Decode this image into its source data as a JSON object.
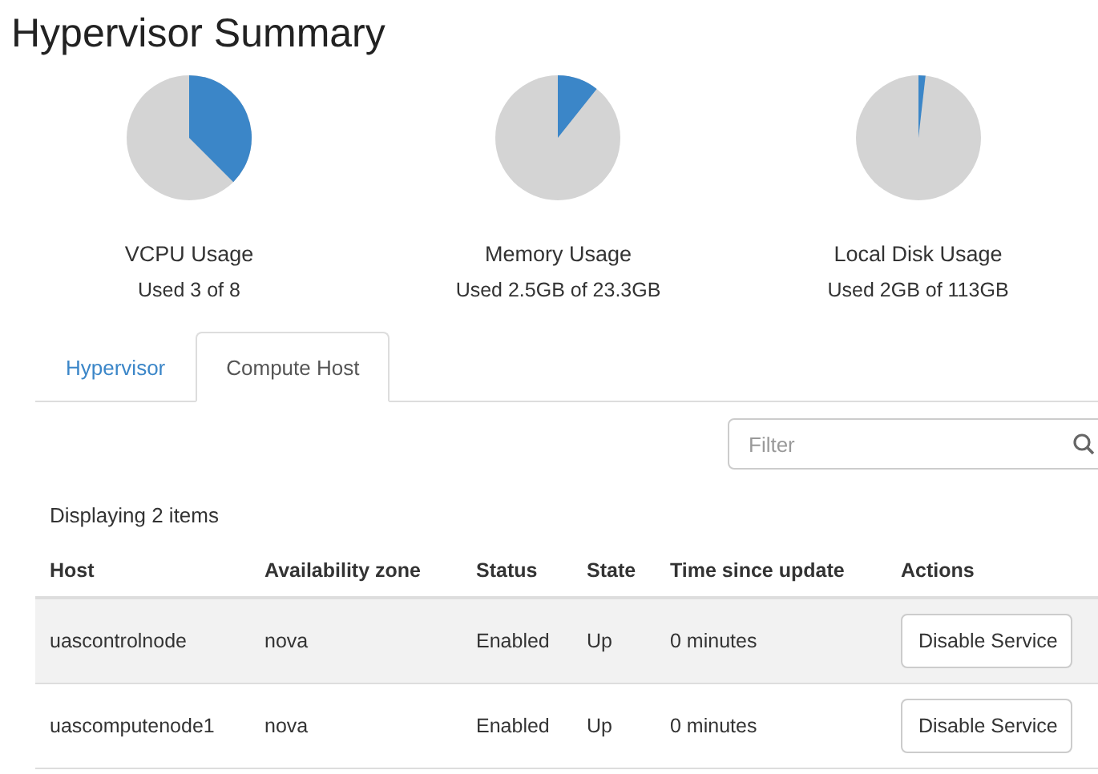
{
  "title": "Hypervisor Summary",
  "usage": [
    {
      "label": "VCPU Usage",
      "detail": "Used 3 of 8"
    },
    {
      "label": "Memory Usage",
      "detail": "Used 2.5GB of 23.3GB"
    },
    {
      "label": "Local Disk Usage",
      "detail": "Used 2GB of 113GB"
    }
  ],
  "tabs": [
    {
      "label": "Hypervisor",
      "selected": false
    },
    {
      "label": "Compute Host",
      "selected": true
    }
  ],
  "filter": {
    "placeholder": "Filter"
  },
  "count": "Displaying 2 items",
  "table": {
    "columns": [
      "Host",
      "Availability zone",
      "Status",
      "State",
      "Time since update",
      "Actions"
    ],
    "rows": [
      {
        "cells": [
          "uascontrolnode",
          "nova",
          "Enabled",
          "Up",
          "0 minutes"
        ],
        "action": "Disable Service",
        "hovered": true
      },
      {
        "cells": [
          "uascomputenode1",
          "nova",
          "Enabled",
          "Up",
          "0 minutes"
        ],
        "action": "Disable Service",
        "hovered": false
      }
    ]
  }
}
